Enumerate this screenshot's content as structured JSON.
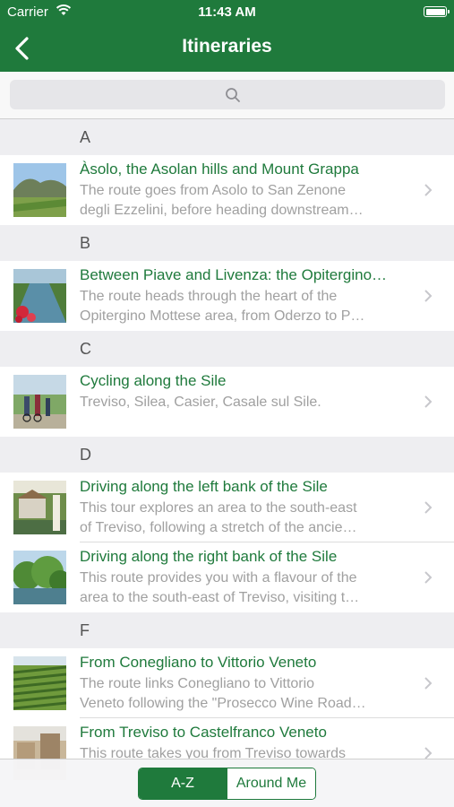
{
  "status_bar": {
    "carrier": "Carrier",
    "time": "11:43 AM",
    "battery_level": 1.0
  },
  "nav": {
    "title": "Itineraries",
    "back_icon": "chevron-left-icon"
  },
  "search": {
    "placeholder": "",
    "icon": "search-icon"
  },
  "sections": [
    {
      "header": "A",
      "items": [
        {
          "title": "Àsolo, the Asolan hills and Mount Grappa",
          "desc_line1": "The route goes from Asolo to San Zenone",
          "desc_line2": "degli Ezzelini, before heading downstream…"
        }
      ]
    },
    {
      "header": "B",
      "items": [
        {
          "title": "Between Piave and Livenza: the Opitergino…",
          "desc_line1": "The route heads through the heart of the",
          "desc_line2": "Opitergino Mottese area, from Oderzo to P…"
        }
      ]
    },
    {
      "header": "C",
      "items": [
        {
          "title": "Cycling along the Sile",
          "desc_line1": "Treviso, Silea, Casier, Casale sul Sile.",
          "desc_line2": ""
        }
      ]
    },
    {
      "header": "D",
      "items": [
        {
          "title": "Driving along the left bank of the Sile",
          "desc_line1": "This tour explores an area to the south-east",
          "desc_line2": "of Treviso, following a stretch of the ancie…"
        },
        {
          "title": "Driving along the right bank of the Sile",
          "desc_line1": "This route provides you with a flavour of the",
          "desc_line2": "area to the south-east of Treviso, visiting t…"
        }
      ]
    },
    {
      "header": "F",
      "items": [
        {
          "title": "From Conegliano to Vittorio Veneto",
          "desc_line1": "The route links Conegliano to Vittorio",
          "desc_line2": "Veneto following the \"Prosecco Wine Road…"
        },
        {
          "title": "From Treviso to Castelfranco Veneto",
          "desc_line1": "This route takes you from Treviso towards",
          "desc_line2": ""
        }
      ]
    }
  ],
  "segmented_control": {
    "options": [
      "A-Z",
      "Around Me"
    ],
    "selected": "A-Z"
  },
  "colors": {
    "brand_green": "#1f7a3c",
    "section_bg": "#eeeef1",
    "subtitle_gray": "#a0a0a0"
  }
}
